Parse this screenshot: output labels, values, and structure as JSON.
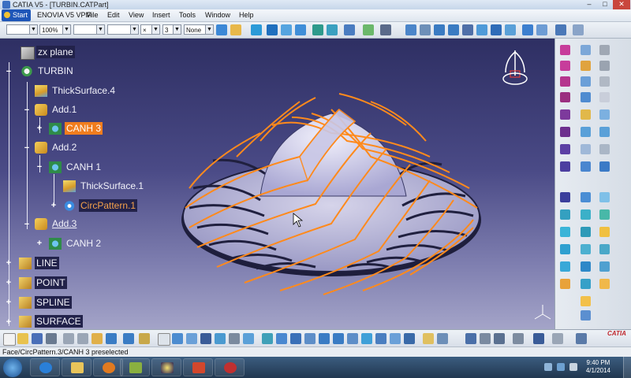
{
  "window": {
    "title": "CATIA V5 - [TURBIN.CATPart]",
    "minimize": "–",
    "maximize": "□",
    "close": "✕"
  },
  "menu": [
    "Start",
    "ENOVIA V5 VPM",
    "File",
    "Edit",
    "View",
    "Insert",
    "Tools",
    "Window",
    "Help"
  ],
  "toolbar": {
    "zoom_value": "100%",
    "layer_value": "None",
    "thickness_value": "3",
    "cross_value": "×"
  },
  "tree": [
    {
      "label": "zx plane",
      "icon": "plane-icon"
    },
    {
      "label": "TURBIN",
      "icon": "part-gear-icon"
    },
    {
      "label": "ThickSurface.4",
      "icon": "thick-surface-icon"
    },
    {
      "label": "Add.1",
      "icon": "boolean-add-icon"
    },
    {
      "label": "CANH 3",
      "icon": "body-icon"
    },
    {
      "label": "Add.2",
      "icon": "boolean-add-icon"
    },
    {
      "label": "CANH 1",
      "icon": "body-icon"
    },
    {
      "label": "ThickSurface.1",
      "icon": "thick-surface-icon"
    },
    {
      "label": "CircPattern.1",
      "icon": "circ-pattern-icon"
    },
    {
      "label": "Add.3",
      "icon": "boolean-add-icon"
    },
    {
      "label": "CANH 2",
      "icon": "body-icon"
    },
    {
      "label": "LINE",
      "icon": "geometrical-set-icon"
    },
    {
      "label": "POINT",
      "icon": "geometrical-set-icon"
    },
    {
      "label": "SPLINE",
      "icon": "geometrical-set-icon"
    },
    {
      "label": "SURFACE",
      "icon": "geometrical-set-icon"
    }
  ],
  "status": {
    "text": "Face/CircPattern.3/CANH 3 preselected"
  },
  "brand": {
    "logo_text": "CATIA"
  },
  "taskbar": {
    "time": "9:40 PM",
    "date": "4/1/2014",
    "apps": [
      "windows-start-icon",
      "ie-icon",
      "folder-icon",
      "media-player-icon",
      "catia-app-icon",
      "space-image-icon",
      "powerpoint-icon",
      "recorder-icon"
    ]
  },
  "colors": {
    "highlight": "#f07d1e",
    "blade_edge": "#ff8a1c",
    "viewport_top": "#2e2f63",
    "viewport_bottom": "#a4a4c8"
  }
}
